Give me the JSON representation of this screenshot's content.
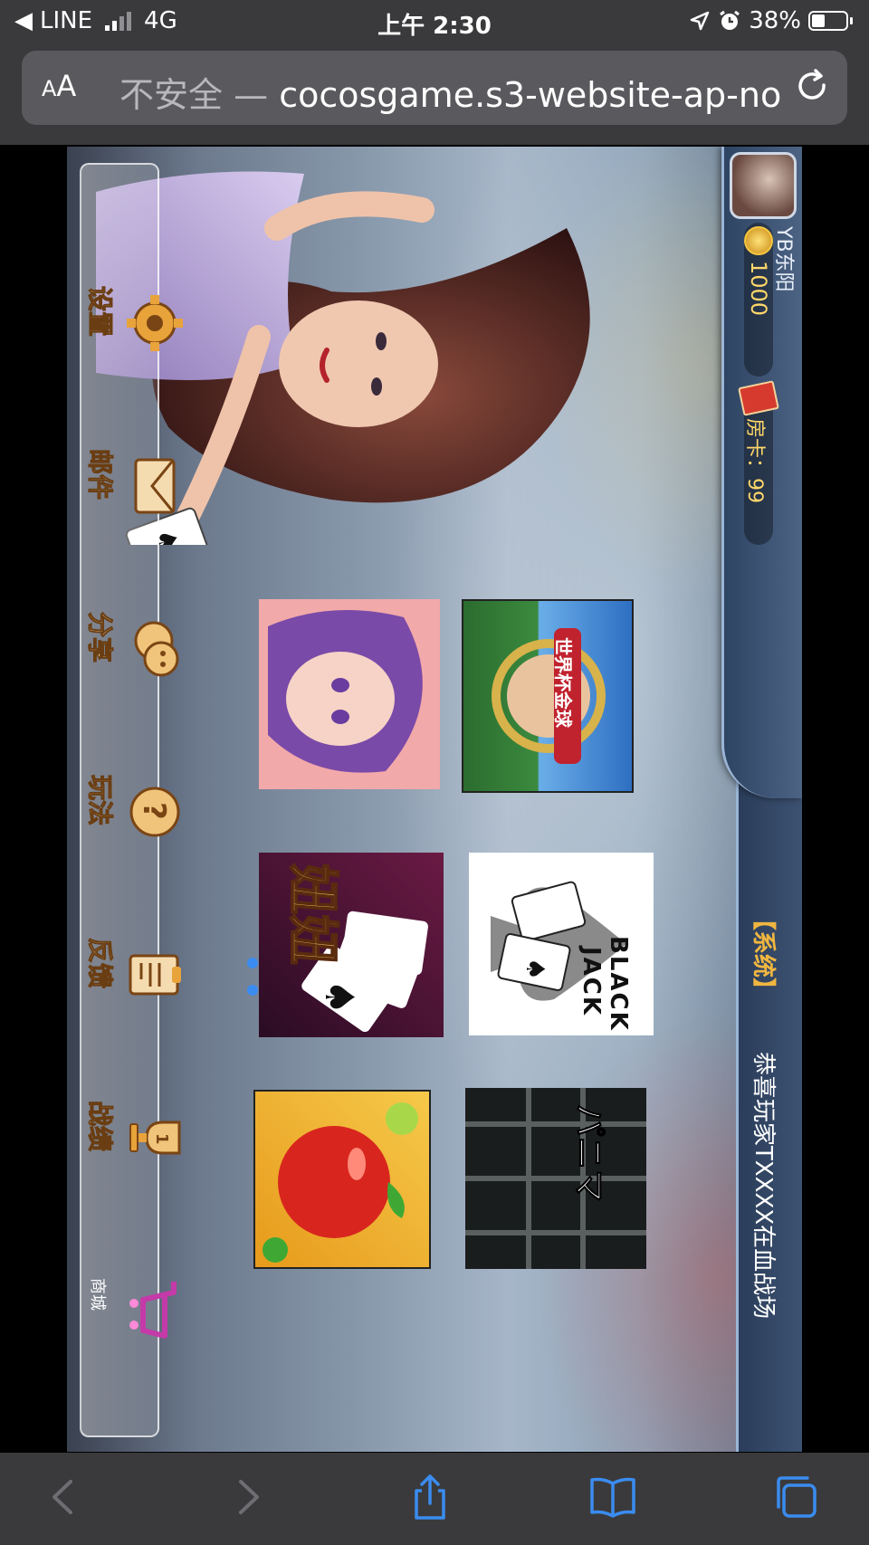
{
  "status": {
    "back_app": "LINE",
    "network": "4G",
    "time": "上午 2:30",
    "battery": "38%"
  },
  "browser": {
    "text_size_label": "AA",
    "insecure_label": "不安全",
    "url": "cocosgame.s3-website-ap-no"
  },
  "game": {
    "player": {
      "name": "YB东阳",
      "coins": "1000",
      "room_cards": "房卡：99"
    },
    "system_tag": "【系统】",
    "marquee": "恭喜玩家TXXXX在血战场",
    "tiles": {
      "soccer": "世界杯金球",
      "blackjack_1": "BLACK",
      "blackjack_2": "JACK",
      "niuniu": "妞妞",
      "bar": "パニマ"
    },
    "menu": {
      "settings": "设置",
      "mail": "邮件",
      "share": "分享",
      "help": "玩法",
      "feedback": "反馈",
      "record": "战绩",
      "shop": "商城"
    },
    "colors": {
      "gold": "#f6e3b6",
      "system": "#f0b640",
      "accent_blue": "#3a8cf0"
    }
  },
  "toolbar": {
    "icons": [
      "back-icon",
      "forward-icon",
      "share-icon",
      "bookmarks-icon",
      "tabs-icon"
    ]
  }
}
